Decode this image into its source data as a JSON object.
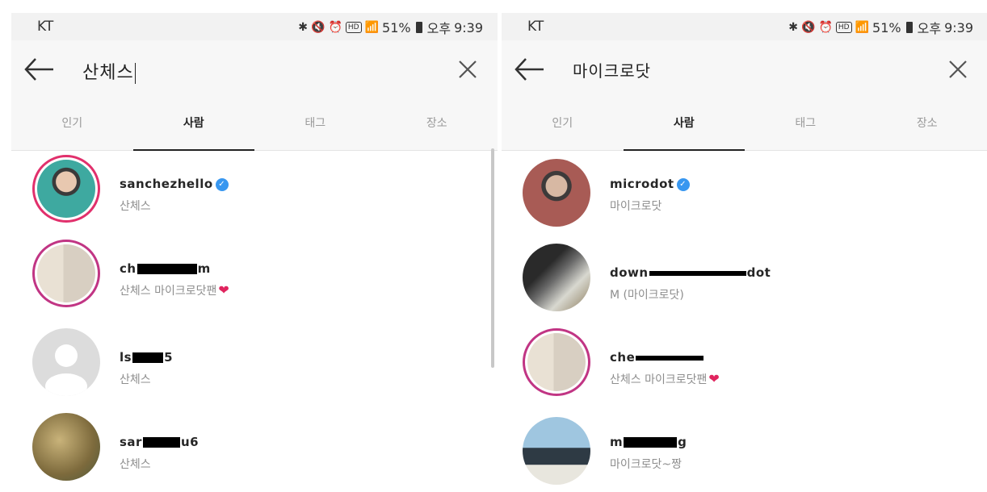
{
  "left": {
    "status": {
      "carrier": "KT",
      "battery": "51%",
      "ampm": "오후",
      "time": "9:39"
    },
    "search": {
      "query": "산체스"
    },
    "tabs": [
      {
        "label": "인기",
        "active": false
      },
      {
        "label": "사람",
        "active": true
      },
      {
        "label": "태그",
        "active": false
      },
      {
        "label": "장소",
        "active": false
      }
    ],
    "results": [
      {
        "username": "sanchezhello",
        "fullname": "산체스",
        "verified": true
      },
      {
        "username_prefix": "ch",
        "username_suffix": "m",
        "fullname": "산체스 마이크로닷팬",
        "heart": "❤"
      },
      {
        "username_prefix": "ls",
        "username_suffix": "5",
        "fullname": "산체스"
      },
      {
        "username_prefix": "sar",
        "username_suffix": "u6",
        "fullname": "산체스"
      }
    ]
  },
  "right": {
    "status": {
      "carrier": "KT",
      "battery": "51%",
      "ampm": "오후",
      "time": "9:39"
    },
    "search": {
      "query": "마이크로닷"
    },
    "tabs": [
      {
        "label": "인기",
        "active": false
      },
      {
        "label": "사람",
        "active": true
      },
      {
        "label": "태그",
        "active": false
      },
      {
        "label": "장소",
        "active": false
      }
    ],
    "results": [
      {
        "username": "microdot",
        "fullname": "마이크로닷",
        "verified": true
      },
      {
        "username_prefix": "down",
        "username_suffix": "dot",
        "fullname": "M (마이크로닷)"
      },
      {
        "username_prefix": "che",
        "username_suffix": "",
        "fullname": "산체스 마이크로닷팬",
        "heart": "❤"
      },
      {
        "username_prefix": "m",
        "username_suffix": "g",
        "fullname": "마이크로닷~짱"
      }
    ]
  },
  "icons": {
    "back": "arrow-left-icon",
    "close": "close-x-icon",
    "verified": "verified-badge-icon"
  },
  "colors": {
    "verified": "#3897f0",
    "story_ring": "#d6249f",
    "heart": "#e0245e",
    "secondary_text": "#8e8e8e"
  }
}
